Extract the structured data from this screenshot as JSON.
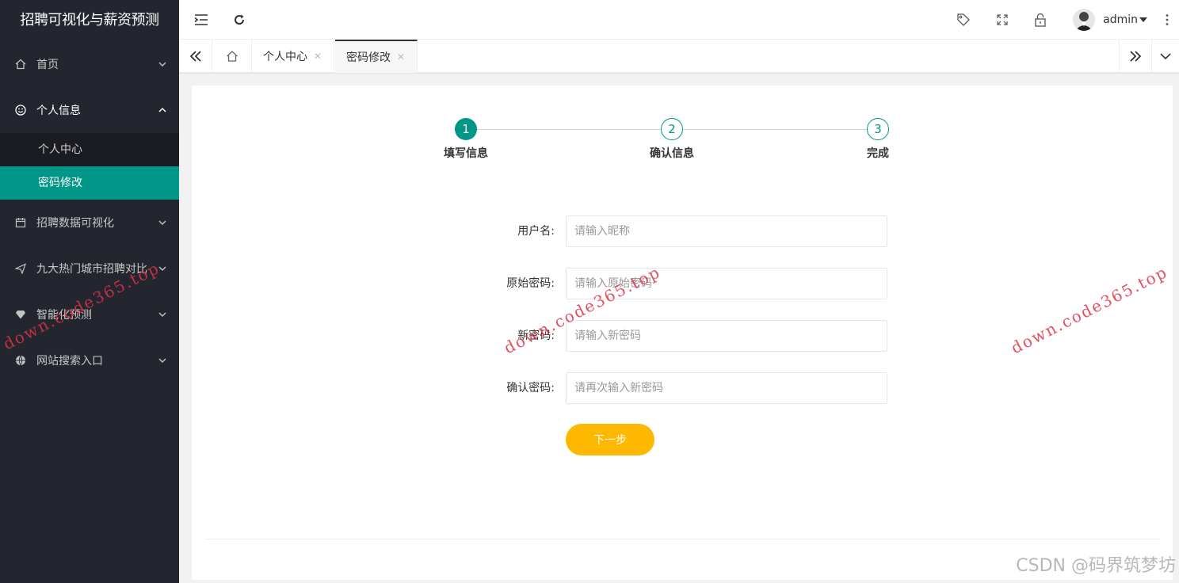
{
  "app": {
    "title": "招聘可视化与薪资预测"
  },
  "sidebar": {
    "items": [
      {
        "label": "首页",
        "icon": "home-icon"
      },
      {
        "label": "个人信息",
        "icon": "smile-icon",
        "open": true,
        "children": [
          {
            "label": "个人中心"
          },
          {
            "label": "密码修改",
            "active": true
          }
        ]
      },
      {
        "label": "招聘数据可视化",
        "icon": "calendar-icon"
      },
      {
        "label": "九大热门城市招聘对比",
        "icon": "send-icon"
      },
      {
        "label": "智能化预测",
        "icon": "diamond-icon"
      },
      {
        "label": "网站搜索入口",
        "icon": "globe-icon"
      }
    ]
  },
  "header": {
    "user": "admin"
  },
  "tabs": [
    {
      "label": "个人中心"
    },
    {
      "label": "密码修改",
      "active": true
    }
  ],
  "steps": [
    {
      "num": "1",
      "label": "填写信息",
      "state": "done"
    },
    {
      "num": "2",
      "label": "确认信息",
      "state": "todo"
    },
    {
      "num": "3",
      "label": "完成",
      "state": "todo"
    }
  ],
  "form": {
    "username": {
      "label": "用户名:",
      "placeholder": "请输入昵称"
    },
    "old_password": {
      "label": "原始密码:",
      "placeholder": "请输入原始密码"
    },
    "new_password": {
      "label": "新密码:",
      "placeholder": "请输入新密码"
    },
    "confirm_password": {
      "label": "确认密码:",
      "placeholder": "请再次输入新密码"
    },
    "next_label": "下一步"
  },
  "colors": {
    "primary": "#009688",
    "sidebar": "#23262e",
    "warm": "#ffb800"
  },
  "watermarks": [
    "down.code365.top",
    "down.code365.top",
    "down.code365.top"
  ],
  "footer_watermark": "CSDN @码界筑梦坊"
}
